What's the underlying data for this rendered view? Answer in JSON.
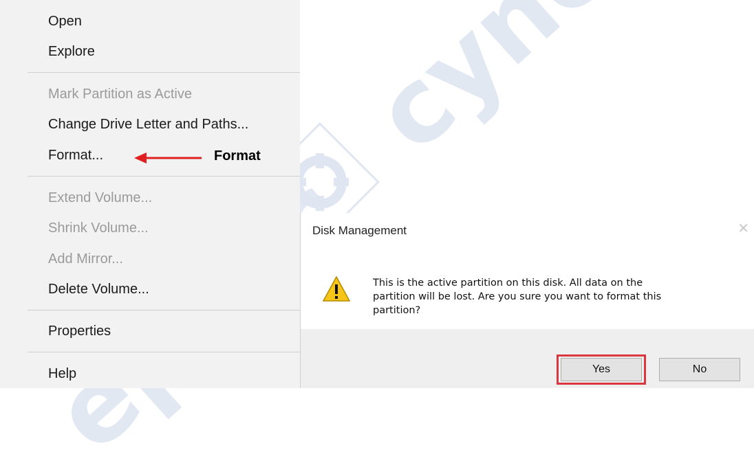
{
  "menu": {
    "items": [
      {
        "label": "Open"
      },
      {
        "label": "Explore"
      },
      {
        "label": "Mark Partition as Active"
      },
      {
        "label": "Change Drive Letter and Paths..."
      },
      {
        "label": "Format..."
      },
      {
        "label": "Extend Volume..."
      },
      {
        "label": "Shrink Volume..."
      },
      {
        "label": "Add Mirror..."
      },
      {
        "label": "Delete Volume..."
      },
      {
        "label": "Properties"
      },
      {
        "label": "Help"
      }
    ]
  },
  "annotation": {
    "label": "Format",
    "color": "#e02020"
  },
  "dialog": {
    "title": "Disk Management",
    "message": "This is the active partition on this disk. All data on the partition will be lost. Are you sure you want to format this partition?",
    "yes_label": "Yes",
    "no_label": "No",
    "highlight_color": "#d9363e"
  },
  "icons": {
    "warning": "warning-icon",
    "close": "close-icon"
  }
}
